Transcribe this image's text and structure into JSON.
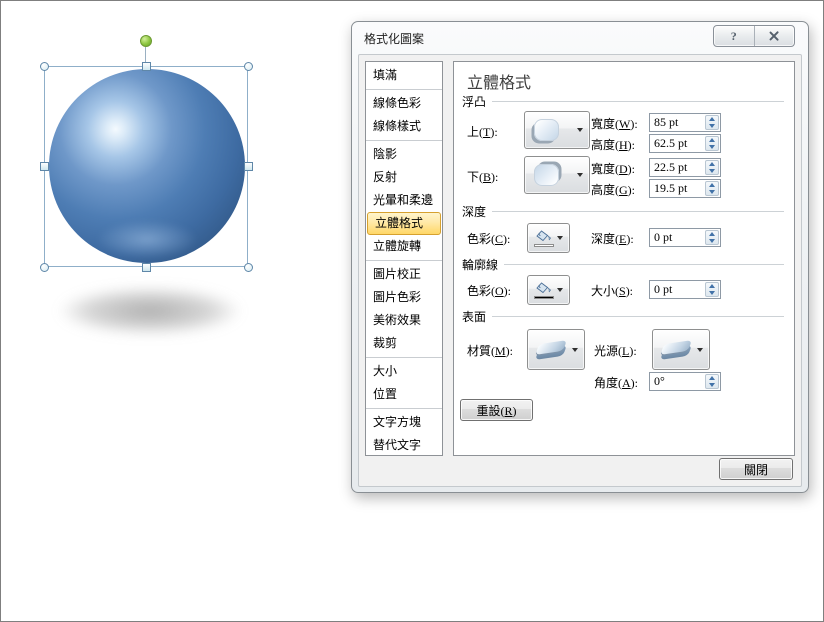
{
  "window": {
    "title": "格式化圖案",
    "help_glyph": "?"
  },
  "sidebar": {
    "selected": "立體格式",
    "groups": [
      [
        "填滿"
      ],
      [
        "線條色彩",
        "線條樣式"
      ],
      [
        "陰影",
        "反射",
        "光暈和柔邊",
        "立體格式",
        "立體旋轉"
      ],
      [
        "圖片校正",
        "圖片色彩",
        "美術效果",
        "裁剪"
      ],
      [
        "大小",
        "位置"
      ],
      [
        "文字方塊",
        "替代文字"
      ]
    ]
  },
  "panel": {
    "title": "立體格式",
    "bevel": {
      "section": "浮凸",
      "top_label": "上(T):",
      "bottom_label": "下(B):",
      "fields": [
        {
          "label": "寬度(W):",
          "value": "85 pt"
        },
        {
          "label": "高度(H):",
          "value": "62.5 pt"
        },
        {
          "label": "寬度(D):",
          "value": "22.5 pt"
        },
        {
          "label": "高度(G):",
          "value": "19.5 pt"
        }
      ]
    },
    "depth": {
      "section": "深度",
      "color_label": "色彩(C):",
      "swatch": "#FFFFFF",
      "field_label": "深度(E):",
      "field_value": "0 pt"
    },
    "contour": {
      "section": "輪廓線",
      "color_label": "色彩(O):",
      "swatch": "#000000",
      "field_label": "大小(S):",
      "field_value": "0 pt"
    },
    "surface": {
      "section": "表面",
      "material_label": "材質(M):",
      "light_label": "光源(L):",
      "angle_label": "角度(A):",
      "angle_value": "0°"
    },
    "reset_label": "重設(R)",
    "close_label": "關閉"
  },
  "canvas": {
    "shape": "blue-sphere",
    "accent_color": "#4F81BD",
    "selection_color": "#8FAFC9",
    "rotation_handle_color": "#8CC63F"
  }
}
